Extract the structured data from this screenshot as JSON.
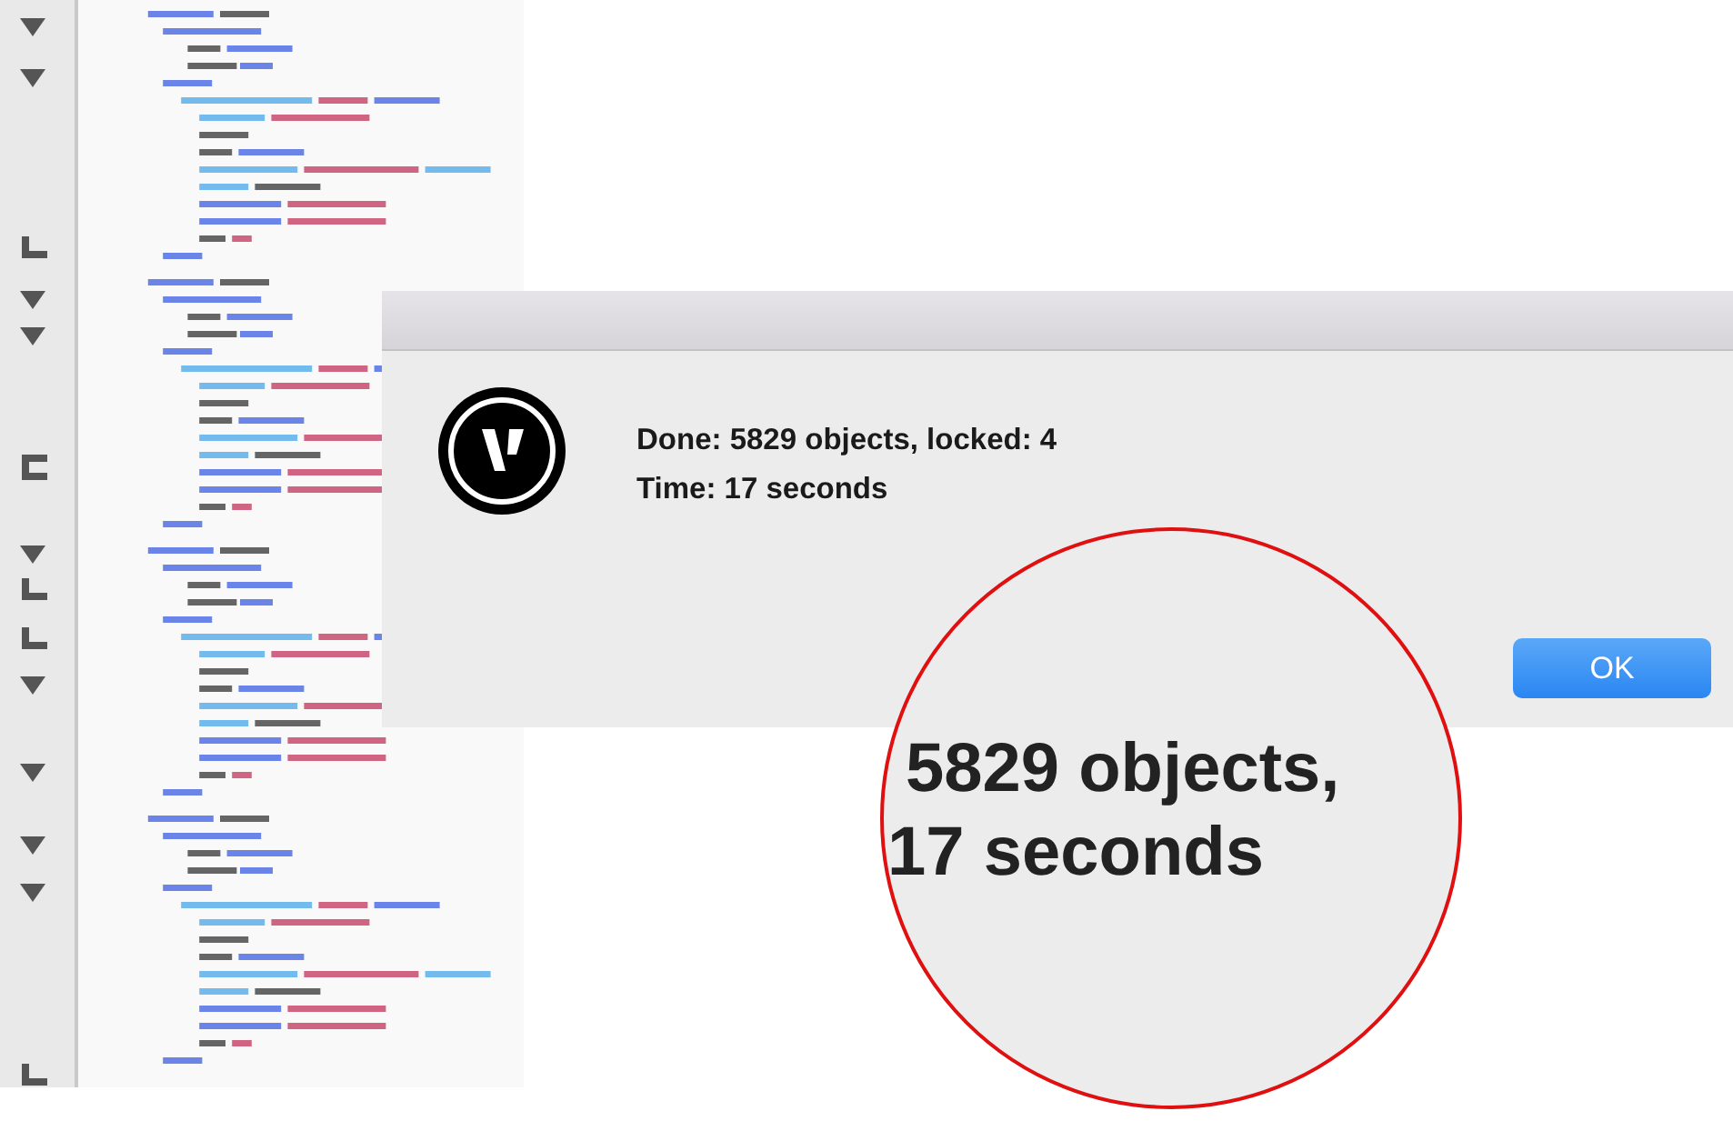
{
  "dialog": {
    "message_lines": [
      "Done: 5829 objects, locked: 4",
      "Time: 17 seconds"
    ],
    "buttons": [
      {
        "label": "OK",
        "default": true
      }
    ]
  },
  "magnifier": {
    "lines": [
      "5829 objects,",
      "17 seconds"
    ]
  }
}
